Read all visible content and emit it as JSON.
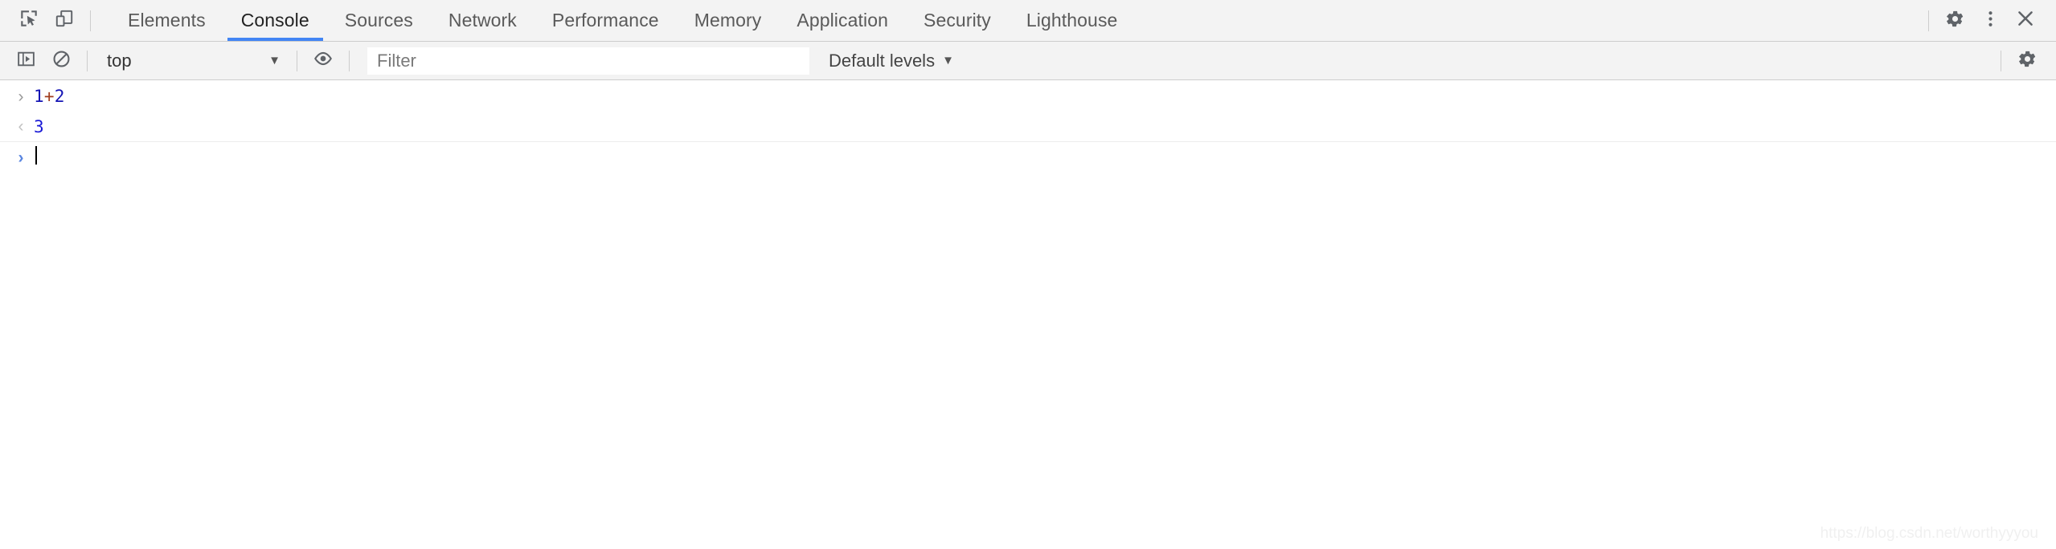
{
  "tabbar": {
    "inspect_icon": "inspect-element-icon",
    "device_icon": "device-toolbar-icon",
    "tabs": [
      {
        "label": "Elements",
        "active": false
      },
      {
        "label": "Console",
        "active": true
      },
      {
        "label": "Sources",
        "active": false
      },
      {
        "label": "Network",
        "active": false
      },
      {
        "label": "Performance",
        "active": false
      },
      {
        "label": "Memory",
        "active": false
      },
      {
        "label": "Application",
        "active": false
      },
      {
        "label": "Security",
        "active": false
      },
      {
        "label": "Lighthouse",
        "active": false
      }
    ],
    "settings_icon": "gear-icon",
    "more_icon": "kebab-menu-icon",
    "close_icon": "close-icon",
    "accent_color": "#4285f4"
  },
  "console_toolbar": {
    "sidebar_icon": "console-sidebar-icon",
    "clear_icon": "clear-console-icon",
    "context": {
      "value": "top",
      "caret": "▼"
    },
    "eye_icon": "live-expression-eye-icon",
    "filter": {
      "value": "",
      "placeholder": "Filter"
    },
    "levels": {
      "label": "Default levels",
      "caret": "▼"
    },
    "settings_icon": "console-settings-gear-icon"
  },
  "console_log": {
    "entries": [
      {
        "kind": "input",
        "gutter": "›",
        "tokens": [
          {
            "text": "1",
            "type": "num"
          },
          {
            "text": "+",
            "type": "op"
          },
          {
            "text": "2",
            "type": "num"
          }
        ],
        "text": "1+2"
      },
      {
        "kind": "output",
        "gutter": "‹",
        "text": "3"
      }
    ],
    "prompt": {
      "gutter": "›",
      "value": ""
    }
  },
  "watermark": {
    "text": "https://blog.csdn.net/worthyyyou"
  }
}
